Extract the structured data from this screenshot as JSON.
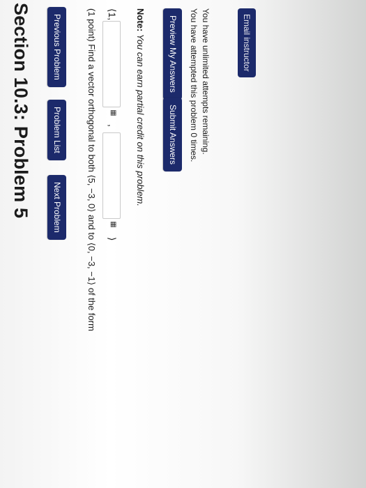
{
  "page": {
    "title": "Section 10.3: Problem 5"
  },
  "nav": {
    "prev": "Previous Problem",
    "list": "Problem List",
    "next": "Next Problem"
  },
  "problem": {
    "question": "(1 point) Find a vector orthogonal to both ⟨5, −3, 0⟩ and to ⟨0, −3, −1⟩ of the form",
    "open": "⟨1,",
    "comma": ",",
    "close": "⟩",
    "input1_value": "",
    "input2_value": "",
    "palette_icon": "▦"
  },
  "note": {
    "bold": "Note:",
    "italic": "You can earn partial credit on this problem."
  },
  "actions": {
    "preview": "Preview My Answers",
    "submit": "Submit Answers"
  },
  "status": {
    "attempts": "You have attempted this problem 0 times.",
    "remaining": "You have unlimited attempts remaining."
  },
  "footer": {
    "email": "Email instructor"
  },
  "colors": {
    "button_bg": "#1c2a6b",
    "button_text": "#ffffff"
  }
}
